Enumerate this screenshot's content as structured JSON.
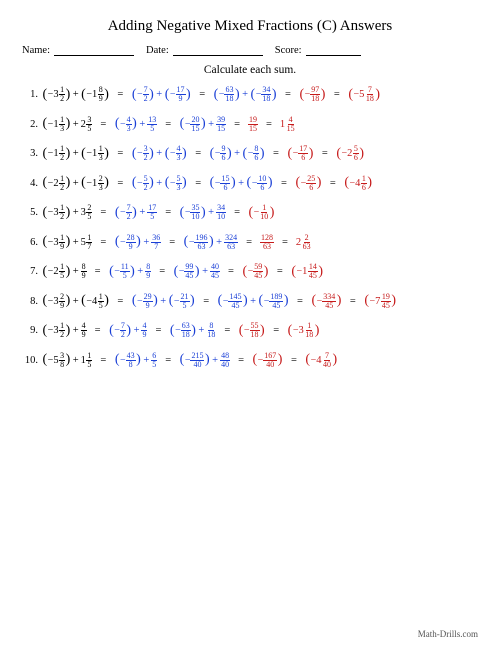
{
  "title": "Adding Negative Mixed Fractions (C) Answers",
  "meta": {
    "name_label": "Name:",
    "date_label": "Date:",
    "score_label": "Score:"
  },
  "instruction": "Calculate each sum.",
  "footer": "Math-Drills.com",
  "rows": [
    {
      "steps": [
        [
          {
            "t": "p",
            "neg": true,
            "w": "3",
            "n": "1",
            "d": "2"
          },
          {
            "t": "plus"
          },
          {
            "t": "p",
            "neg": true,
            "w": "1",
            "n": "8",
            "d": "9"
          }
        ],
        [
          {
            "t": "p",
            "neg": true,
            "n": "7",
            "d": "2",
            "c": "blue"
          },
          {
            "t": "plus",
            "c": "blue"
          },
          {
            "t": "p",
            "neg": true,
            "n": "17",
            "d": "9",
            "c": "blue"
          }
        ],
        [
          {
            "t": "p",
            "neg": true,
            "n": "63",
            "d": "18",
            "c": "blue"
          },
          {
            "t": "plus",
            "c": "blue"
          },
          {
            "t": "p",
            "neg": true,
            "n": "34",
            "d": "18",
            "c": "blue"
          }
        ],
        [
          {
            "t": "p",
            "neg": true,
            "n": "97",
            "d": "18",
            "c": "red"
          }
        ],
        [
          {
            "t": "p",
            "neg": true,
            "w": "5",
            "n": "7",
            "d": "18",
            "c": "red"
          }
        ]
      ]
    },
    {
      "steps": [
        [
          {
            "t": "p",
            "neg": true,
            "w": "1",
            "n": "1",
            "d": "3"
          },
          {
            "t": "plus"
          },
          {
            "t": "m",
            "w": "2",
            "n": "3",
            "d": "5"
          }
        ],
        [
          {
            "t": "p",
            "neg": true,
            "n": "4",
            "d": "3",
            "c": "blue"
          },
          {
            "t": "plus",
            "c": "blue"
          },
          {
            "t": "f",
            "n": "13",
            "d": "5",
            "c": "blue"
          }
        ],
        [
          {
            "t": "p",
            "neg": true,
            "n": "20",
            "d": "15",
            "c": "blue"
          },
          {
            "t": "plus",
            "c": "blue"
          },
          {
            "t": "f",
            "n": "39",
            "d": "15",
            "c": "blue"
          }
        ],
        [
          {
            "t": "f",
            "n": "19",
            "d": "15",
            "c": "red"
          }
        ],
        [
          {
            "t": "m",
            "w": "1",
            "n": "4",
            "d": "15",
            "c": "red"
          }
        ]
      ]
    },
    {
      "steps": [
        [
          {
            "t": "p",
            "neg": true,
            "w": "1",
            "n": "1",
            "d": "2"
          },
          {
            "t": "plus"
          },
          {
            "t": "p",
            "neg": true,
            "w": "1",
            "n": "1",
            "d": "3"
          }
        ],
        [
          {
            "t": "p",
            "neg": true,
            "n": "3",
            "d": "2",
            "c": "blue"
          },
          {
            "t": "plus",
            "c": "blue"
          },
          {
            "t": "p",
            "neg": true,
            "n": "4",
            "d": "3",
            "c": "blue"
          }
        ],
        [
          {
            "t": "p",
            "neg": true,
            "n": "9",
            "d": "6",
            "c": "blue"
          },
          {
            "t": "plus",
            "c": "blue"
          },
          {
            "t": "p",
            "neg": true,
            "n": "8",
            "d": "6",
            "c": "blue"
          }
        ],
        [
          {
            "t": "p",
            "neg": true,
            "n": "17",
            "d": "6",
            "c": "red"
          }
        ],
        [
          {
            "t": "p",
            "neg": true,
            "w": "2",
            "n": "5",
            "d": "6",
            "c": "red"
          }
        ]
      ]
    },
    {
      "steps": [
        [
          {
            "t": "p",
            "neg": true,
            "w": "2",
            "n": "1",
            "d": "2"
          },
          {
            "t": "plus"
          },
          {
            "t": "p",
            "neg": true,
            "w": "1",
            "n": "2",
            "d": "3"
          }
        ],
        [
          {
            "t": "p",
            "neg": true,
            "n": "5",
            "d": "2",
            "c": "blue"
          },
          {
            "t": "plus",
            "c": "blue"
          },
          {
            "t": "p",
            "neg": true,
            "n": "5",
            "d": "3",
            "c": "blue"
          }
        ],
        [
          {
            "t": "p",
            "neg": true,
            "n": "15",
            "d": "6",
            "c": "blue"
          },
          {
            "t": "plus",
            "c": "blue"
          },
          {
            "t": "p",
            "neg": true,
            "n": "10",
            "d": "6",
            "c": "blue"
          }
        ],
        [
          {
            "t": "p",
            "neg": true,
            "n": "25",
            "d": "6",
            "c": "red"
          }
        ],
        [
          {
            "t": "p",
            "neg": true,
            "w": "4",
            "n": "1",
            "d": "6",
            "c": "red"
          }
        ]
      ]
    },
    {
      "steps": [
        [
          {
            "t": "p",
            "neg": true,
            "w": "3",
            "n": "1",
            "d": "2"
          },
          {
            "t": "plus"
          },
          {
            "t": "m",
            "w": "3",
            "n": "2",
            "d": "5"
          }
        ],
        [
          {
            "t": "p",
            "neg": true,
            "n": "7",
            "d": "2",
            "c": "blue"
          },
          {
            "t": "plus",
            "c": "blue"
          },
          {
            "t": "f",
            "n": "17",
            "d": "5",
            "c": "blue"
          }
        ],
        [
          {
            "t": "p",
            "neg": true,
            "n": "35",
            "d": "10",
            "c": "blue"
          },
          {
            "t": "plus",
            "c": "blue"
          },
          {
            "t": "f",
            "n": "34",
            "d": "10",
            "c": "blue"
          }
        ],
        [
          {
            "t": "p",
            "neg": true,
            "n": "1",
            "d": "10",
            "c": "red"
          }
        ]
      ]
    },
    {
      "steps": [
        [
          {
            "t": "p",
            "neg": true,
            "w": "3",
            "n": "1",
            "d": "9"
          },
          {
            "t": "plus"
          },
          {
            "t": "m",
            "w": "5",
            "n": "1",
            "d": "7"
          }
        ],
        [
          {
            "t": "p",
            "neg": true,
            "n": "28",
            "d": "9",
            "c": "blue"
          },
          {
            "t": "plus",
            "c": "blue"
          },
          {
            "t": "f",
            "n": "36",
            "d": "7",
            "c": "blue"
          }
        ],
        [
          {
            "t": "p",
            "neg": true,
            "n": "196",
            "d": "63",
            "c": "blue"
          },
          {
            "t": "plus",
            "c": "blue"
          },
          {
            "t": "f",
            "n": "324",
            "d": "63",
            "c": "blue"
          }
        ],
        [
          {
            "t": "f",
            "n": "128",
            "d": "63",
            "c": "red"
          }
        ],
        [
          {
            "t": "m",
            "w": "2",
            "n": "2",
            "d": "63",
            "c": "red"
          }
        ]
      ]
    },
    {
      "steps": [
        [
          {
            "t": "p",
            "neg": true,
            "w": "2",
            "n": "1",
            "d": "5"
          },
          {
            "t": "plus"
          },
          {
            "t": "f",
            "n": "8",
            "d": "9"
          }
        ],
        [
          {
            "t": "p",
            "neg": true,
            "n": "11",
            "d": "5",
            "c": "blue"
          },
          {
            "t": "plus",
            "c": "blue"
          },
          {
            "t": "f",
            "n": "8",
            "d": "9",
            "c": "blue"
          }
        ],
        [
          {
            "t": "p",
            "neg": true,
            "n": "99",
            "d": "45",
            "c": "blue"
          },
          {
            "t": "plus",
            "c": "blue"
          },
          {
            "t": "f",
            "n": "40",
            "d": "45",
            "c": "blue"
          }
        ],
        [
          {
            "t": "p",
            "neg": true,
            "n": "59",
            "d": "45",
            "c": "red"
          }
        ],
        [
          {
            "t": "p",
            "neg": true,
            "w": "1",
            "n": "14",
            "d": "45",
            "c": "red"
          }
        ]
      ]
    },
    {
      "steps": [
        [
          {
            "t": "p",
            "neg": true,
            "w": "3",
            "n": "2",
            "d": "9"
          },
          {
            "t": "plus"
          },
          {
            "t": "p",
            "neg": true,
            "w": "4",
            "n": "1",
            "d": "5"
          }
        ],
        [
          {
            "t": "p",
            "neg": true,
            "n": "29",
            "d": "9",
            "c": "blue"
          },
          {
            "t": "plus",
            "c": "blue"
          },
          {
            "t": "p",
            "neg": true,
            "n": "21",
            "d": "5",
            "c": "blue"
          }
        ],
        [
          {
            "t": "p",
            "neg": true,
            "n": "145",
            "d": "45",
            "c": "blue"
          },
          {
            "t": "plus",
            "c": "blue"
          },
          {
            "t": "p",
            "neg": true,
            "n": "189",
            "d": "45",
            "c": "blue"
          }
        ],
        [
          {
            "t": "p",
            "neg": true,
            "n": "334",
            "d": "45",
            "c": "red"
          }
        ],
        [
          {
            "t": "p",
            "neg": true,
            "w": "7",
            "n": "19",
            "d": "45",
            "c": "red"
          }
        ]
      ]
    },
    {
      "steps": [
        [
          {
            "t": "p",
            "neg": true,
            "w": "3",
            "n": "1",
            "d": "2"
          },
          {
            "t": "plus"
          },
          {
            "t": "f",
            "n": "4",
            "d": "9"
          }
        ],
        [
          {
            "t": "p",
            "neg": true,
            "n": "7",
            "d": "2",
            "c": "blue"
          },
          {
            "t": "plus",
            "c": "blue"
          },
          {
            "t": "f",
            "n": "4",
            "d": "9",
            "c": "blue"
          }
        ],
        [
          {
            "t": "p",
            "neg": true,
            "n": "63",
            "d": "18",
            "c": "blue"
          },
          {
            "t": "plus",
            "c": "blue"
          },
          {
            "t": "f",
            "n": "8",
            "d": "18",
            "c": "blue"
          }
        ],
        [
          {
            "t": "p",
            "neg": true,
            "n": "55",
            "d": "18",
            "c": "red"
          }
        ],
        [
          {
            "t": "p",
            "neg": true,
            "w": "3",
            "n": "1",
            "d": "18",
            "c": "red"
          }
        ]
      ]
    },
    {
      "steps": [
        [
          {
            "t": "p",
            "neg": true,
            "w": "5",
            "n": "3",
            "d": "8"
          },
          {
            "t": "plus"
          },
          {
            "t": "m",
            "w": "1",
            "n": "1",
            "d": "5"
          }
        ],
        [
          {
            "t": "p",
            "neg": true,
            "n": "43",
            "d": "8",
            "c": "blue"
          },
          {
            "t": "plus",
            "c": "blue"
          },
          {
            "t": "f",
            "n": "6",
            "d": "5",
            "c": "blue"
          }
        ],
        [
          {
            "t": "p",
            "neg": true,
            "n": "215",
            "d": "40",
            "c": "blue"
          },
          {
            "t": "plus",
            "c": "blue"
          },
          {
            "t": "f",
            "n": "48",
            "d": "40",
            "c": "blue"
          }
        ],
        [
          {
            "t": "p",
            "neg": true,
            "n": "167",
            "d": "40",
            "c": "red"
          }
        ],
        [
          {
            "t": "p",
            "neg": true,
            "w": "4",
            "n": "7",
            "d": "40",
            "c": "red"
          }
        ]
      ]
    }
  ]
}
